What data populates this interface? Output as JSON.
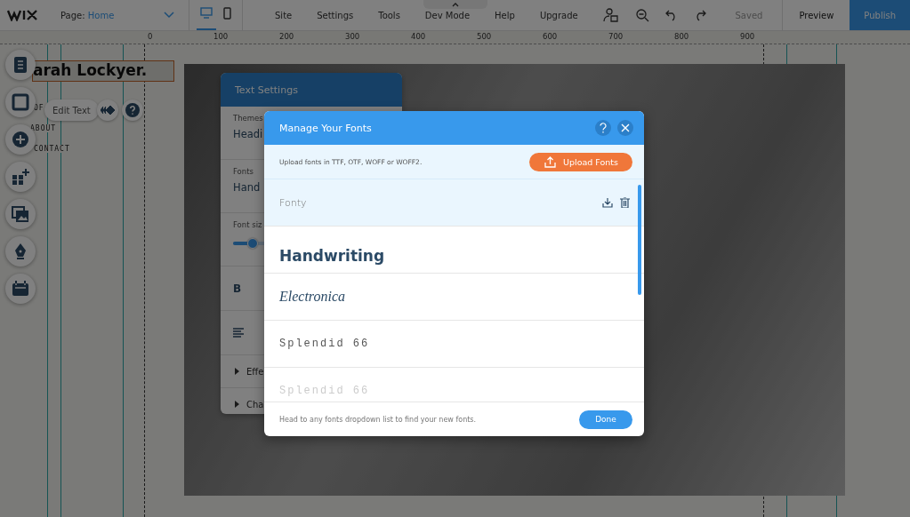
{
  "top_bar": {
    "page_label": "Page:",
    "page_name": "Home",
    "devices": [
      {
        "kind": "desktop",
        "selected": true
      },
      {
        "kind": "mobile",
        "selected": false
      }
    ],
    "menu": [
      "Site",
      "Settings",
      "Tools",
      "Dev Mode",
      "Help",
      "Upgrade"
    ],
    "status": "Saved",
    "preview": "Preview",
    "publish": "Publish"
  },
  "ruler": {
    "ticks": [
      "0",
      "100",
      "200",
      "300",
      "400",
      "500",
      "600",
      "700",
      "800",
      "900"
    ]
  },
  "canvas": {
    "heading": "arah Lockyer.",
    "nav": [
      "OF",
      "ABOUT",
      "CONTACT"
    ],
    "edit_text": "Edit Text"
  },
  "text_settings": {
    "title": "Text Settings",
    "themes_label": "Themes",
    "themes_value": "Headi",
    "fonts_label": "Fonts",
    "fonts_value": "Hand",
    "size_label": "Font siz",
    "size_slider": {
      "level": 0.22
    },
    "bold": "B",
    "sections": [
      "Effe",
      "Cha"
    ]
  },
  "dialog": {
    "title": "Manage Your Fonts",
    "info": "Upload fonts in TTF, OTF, WOFF or WOFF2.",
    "upload": "Upload Fonts",
    "fonts": [
      {
        "name": "Fonty",
        "kind": "thin",
        "selected": true,
        "dimmed": false
      },
      {
        "name": "Handwriting",
        "kind": "bold",
        "selected": false,
        "dimmed": false
      },
      {
        "name": "Electronica",
        "kind": "script",
        "selected": false,
        "dimmed": false
      },
      {
        "name": "Splendid 66",
        "kind": "mono",
        "selected": false,
        "dimmed": false
      },
      {
        "name": "Splendid 66",
        "kind": "mono",
        "selected": false,
        "dimmed": true
      }
    ],
    "footer": "Head to any fonts dropdown list to find your new fonts.",
    "done": "Done"
  }
}
